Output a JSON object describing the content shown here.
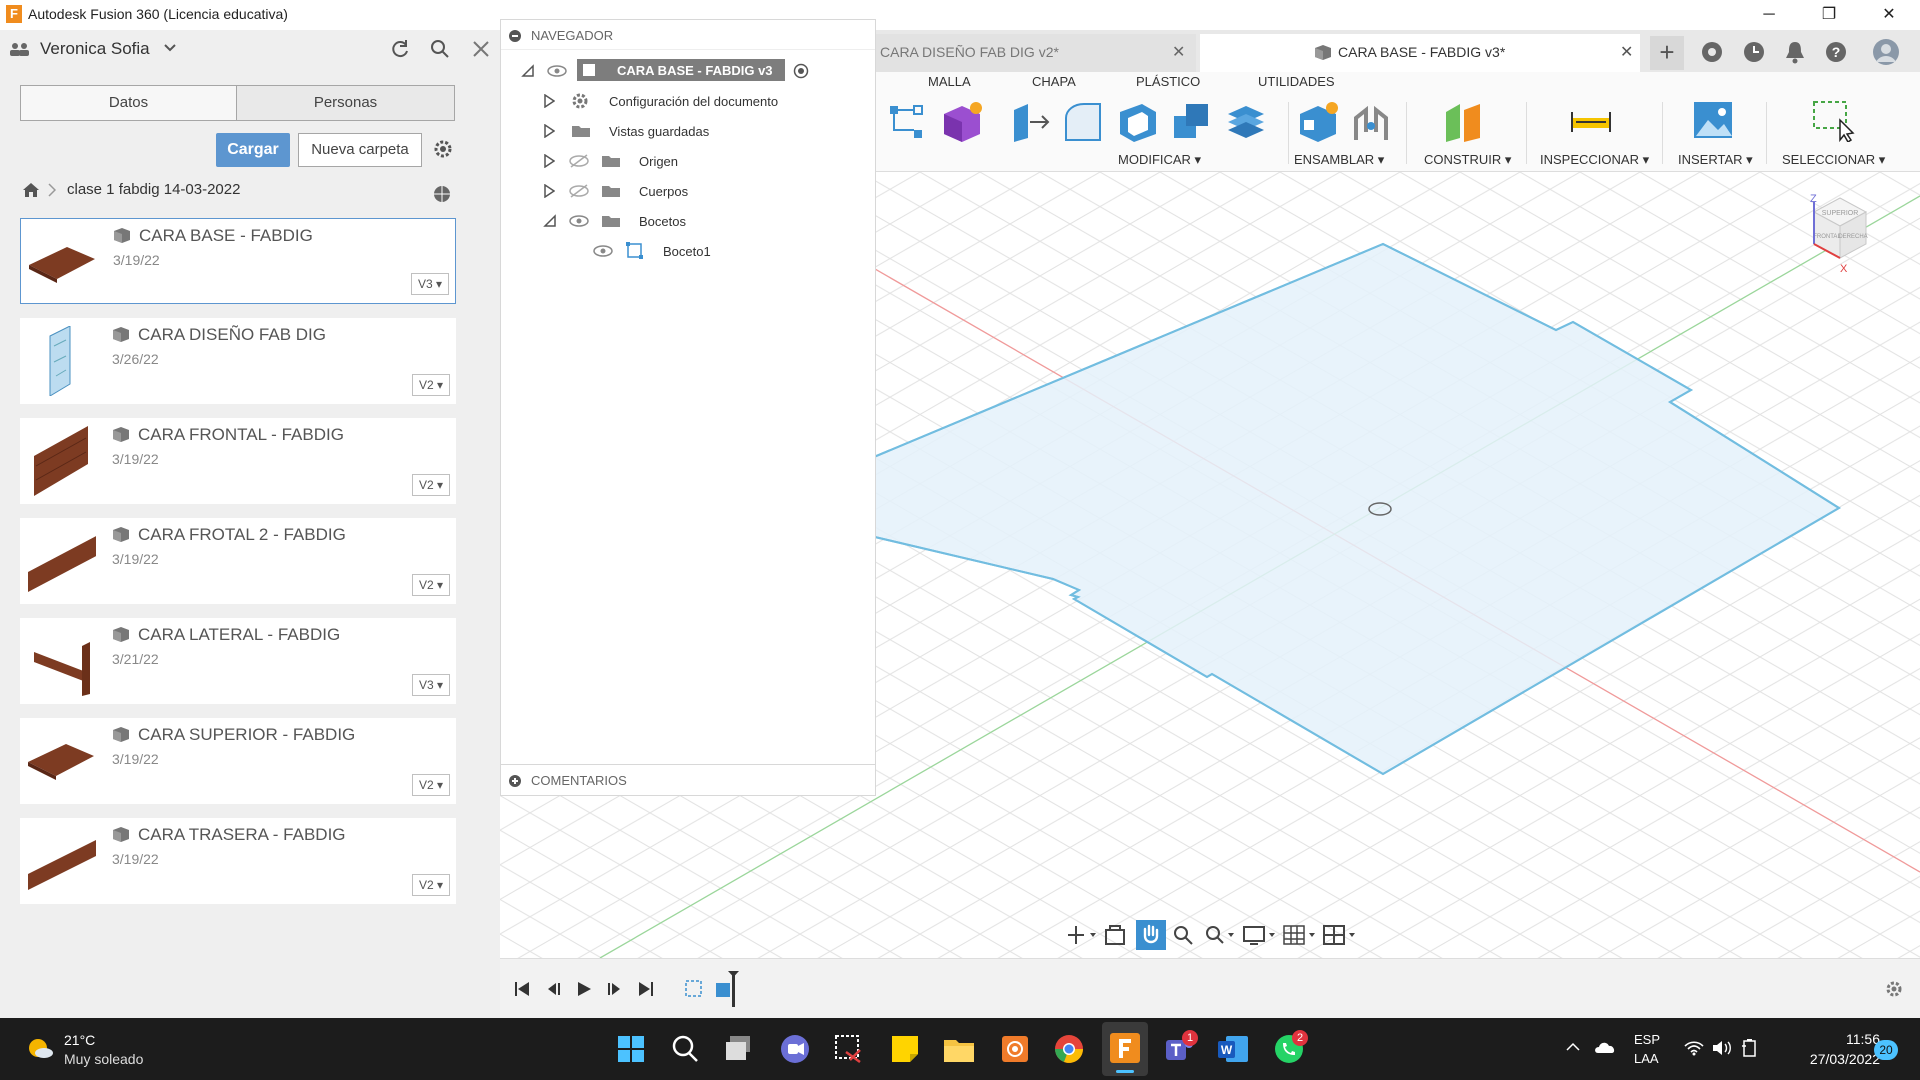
{
  "window": {
    "title": "Autodesk Fusion 360 (Licencia educativa)",
    "logo_letter": "F"
  },
  "left_panel": {
    "user_name": "Veronica Sofia",
    "tabs": {
      "data": "Datos",
      "people": "Personas"
    },
    "upload_label": "Cargar",
    "new_folder_label": "Nueva carpeta",
    "breadcrumb": "clase 1 fabdig 14-03-2022",
    "files": [
      {
        "title": "CARA BASE - FABDIG",
        "date": "3/19/22",
        "version": "V3 ▾"
      },
      {
        "title": "CARA DISEÑO FAB DIG",
        "date": "3/26/22",
        "version": "V2 ▾"
      },
      {
        "title": "CARA FRONTAL - FABDIG",
        "date": "3/19/22",
        "version": "V2 ▾"
      },
      {
        "title": "CARA FROTAL 2 - FABDIG",
        "date": "3/19/22",
        "version": "V2 ▾"
      },
      {
        "title": "CARA LATERAL - FABDIG",
        "date": "3/21/22",
        "version": "V3 ▾"
      },
      {
        "title": "CARA SUPERIOR - FABDIG",
        "date": "3/19/22",
        "version": "V2 ▾"
      },
      {
        "title": "CARA TRASERA - FABDIG",
        "date": "3/19/22",
        "version": "V2 ▾"
      }
    ]
  },
  "navigator": {
    "header": "NAVEGADOR",
    "root": "CARA BASE - FABDIG v3",
    "items": [
      "Configuración del documento",
      "Vistas guardadas",
      "Origen",
      "Cuerpos",
      "Bocetos"
    ],
    "sketch": "Boceto1",
    "comments": "COMENTARIOS"
  },
  "doc_tabs": [
    {
      "label": "CARA DISEÑO FAB DIG v2*"
    },
    {
      "label": "CARA BASE - FABDIG v3*"
    }
  ],
  "toolbar": {
    "menu_tabs": [
      "MALLA",
      "CHAPA",
      "PLÁSTICO",
      "UTILIDADES"
    ],
    "groups": [
      "MODIFICAR ▾",
      "ENSAMBLAR ▾",
      "CONSTRUIR ▾",
      "INSPECCIONAR ▾",
      "INSERTAR ▾",
      "SELECCIONAR ▾"
    ]
  },
  "viewcube": {
    "top": "SUPERIOR",
    "front": "FRONTAL",
    "right": "DERECHA",
    "axis_z": "Z",
    "axis_x": "X"
  },
  "taskbar": {
    "weather_temp": "21°C",
    "weather_desc": "Muy soleado",
    "lang_1": "ESP",
    "lang_2": "LAA",
    "time": "11:56",
    "date": "27/03/2022",
    "notif_count": "20",
    "teams_badge": "1",
    "whatsapp_badge": "2"
  },
  "colors": {
    "accent": "#5d96d0",
    "sketch_fill": "#e4f1fa",
    "sketch_stroke": "#72bde0",
    "wood": "#7d3b22"
  }
}
